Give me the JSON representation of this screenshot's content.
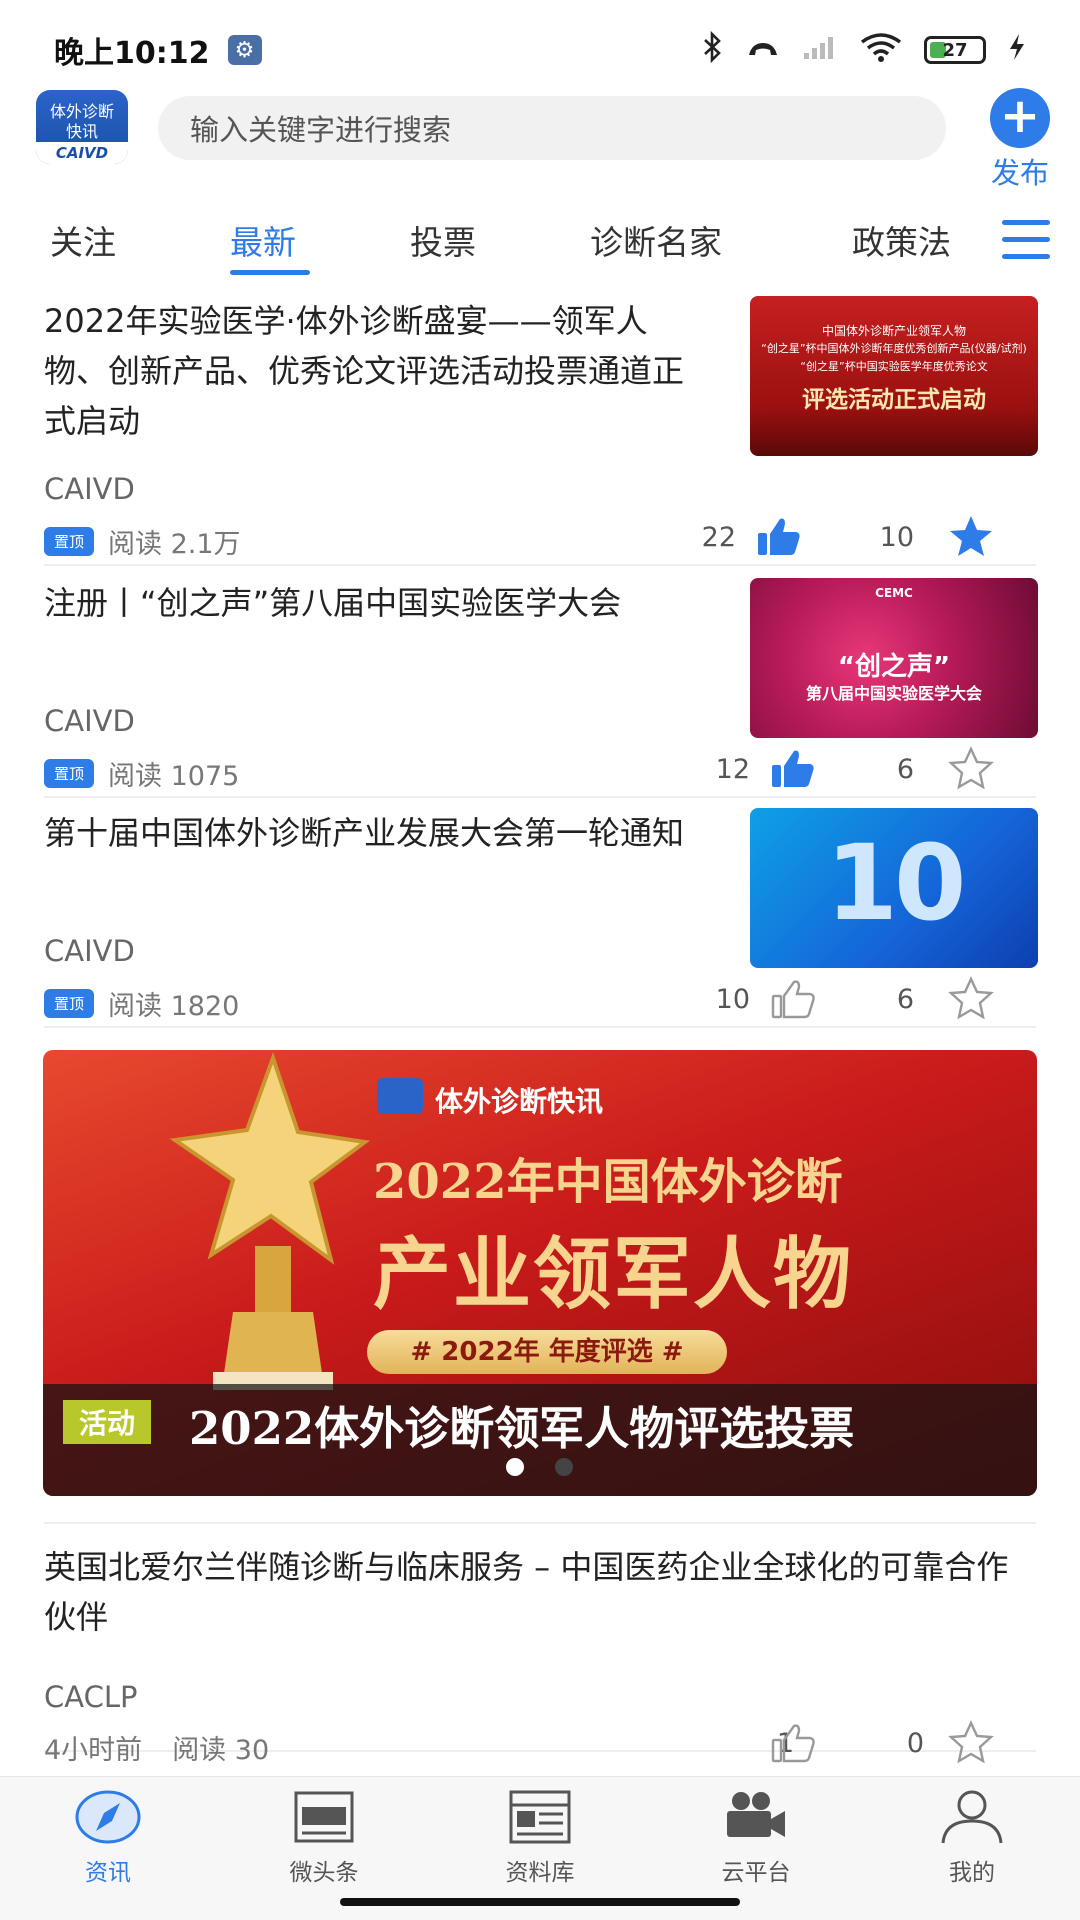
{
  "status": {
    "time": "晚上10:12",
    "battery": "27"
  },
  "header": {
    "logo_line1": "体外诊断",
    "logo_line2": "快讯",
    "logo_line3": "CAIVD",
    "search_placeholder": "输入关键字进行搜索",
    "publish_label": "发布"
  },
  "tabs": [
    {
      "label": "关注"
    },
    {
      "label": "最新"
    },
    {
      "label": "投票"
    },
    {
      "label": "诊断名家"
    },
    {
      "label": "政策法"
    }
  ],
  "articles": [
    {
      "title": "2022年实验医学·体外诊断盛宴——领军人物、创新产品、优秀论文评选活动投票通道正式启动",
      "source": "CAIVD",
      "badge": "置顶",
      "reads": "阅读 2.1万",
      "likes": "22",
      "favs": "10",
      "liked": true,
      "faved": true,
      "thumb_lines": [
        "中国体外诊断产业领军人物",
        "“创之星”杯中国体外诊断年度优秀创新产品(仪器/试剂)",
        "“创之星”杯中国实验医学年度优秀论文",
        "评选活动正式启动"
      ]
    },
    {
      "title": "注册丨“创之声”第八届中国实验医学大会",
      "source": "CAIVD",
      "badge": "置顶",
      "reads": "阅读 1075",
      "likes": "12",
      "favs": "6",
      "liked": true,
      "faved": false,
      "thumb_lines": [
        "CEMC",
        "“创之声”",
        "第八届中国实验医学大会"
      ]
    },
    {
      "title": "第十届中国体外诊断产业发展大会第一轮通知",
      "source": "CAIVD",
      "badge": "置顶",
      "reads": "阅读 1820",
      "likes": "10",
      "favs": "6",
      "liked": false,
      "faved": false,
      "thumb_lines": [
        "10"
      ]
    }
  ],
  "banner": {
    "brand": "体外诊断快讯",
    "line1": "2022年中国体外诊断",
    "line2": "产业领军人物",
    "pill": "# 2022年 年度评选 #",
    "tag": "活动",
    "caption": "2022体外诊断领军人物评选投票"
  },
  "article4": {
    "title": "英国北爱尔兰伴随诊断与临床服务 – 中国医药企业全球化的可靠合作伙伴",
    "source": "CACLP",
    "time": "4小时前",
    "reads": "阅读 30",
    "likes": "1",
    "favs": "0"
  },
  "nav": [
    {
      "label": "资讯"
    },
    {
      "label": "微头条"
    },
    {
      "label": "资料库"
    },
    {
      "label": "云平台"
    },
    {
      "label": "我的"
    }
  ],
  "colors": {
    "accent": "#2d7ce8",
    "text": "#222222",
    "muted": "#777777"
  }
}
